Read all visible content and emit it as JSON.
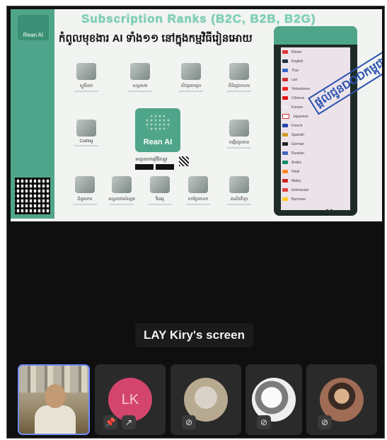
{
  "slide": {
    "sidebar_logo": "Rean AI",
    "banner": "Subscription Ranks (B2C, B2B, B2G)",
    "title": "កំពូលមុខងារ AI ទាំង១១ នៅក្នុងកម្មវិធីរៀនអោយ",
    "center_logo": "Rean AI",
    "store_caption": "ទាញយកកម្មវិធីឥឡូវ",
    "stamp": "ផ្តល់ជូនDODកម្ពុជា",
    "features": [
      {
        "label": "ស្ទូឌីយោ"
      },
      {
        "label": "សន្ទនាAI"
      },
      {
        "label": "សិក្សាតាមរូប"
      },
      {
        "label": "ពិនិត្យឯកសារ"
      },
      {
        "label": "Coding"
      },
      {
        "label": "បង្កើតរូបភាព"
      },
      {
        "label": "ជំនួយការ"
      },
      {
        "label": "សន្ទនាជាសំឡេង"
      },
      {
        "label": "វីដេអូ"
      },
      {
        "label": "បកប្រែភាសា"
      },
      {
        "label": "គណិតវិទ្យា"
      }
    ],
    "phone_languages": [
      "Khmer",
      "English",
      "Thai",
      "Lao",
      "Vietnamese",
      "Chinese",
      "Korean",
      "Japanese",
      "French",
      "Spanish",
      "German",
      "Russian",
      "Arabic",
      "Hindi",
      "Malay",
      "Indonesian",
      "Burmese"
    ],
    "phone_nav": "<  >"
  },
  "screen_share_label": "LAY Kiry's screen",
  "participants": [
    {
      "kind": "camera",
      "active": true
    },
    {
      "kind": "initials",
      "initials": "LK",
      "controls": [
        "pin-icon",
        "share-icon"
      ]
    },
    {
      "kind": "photo",
      "muted": true
    },
    {
      "kind": "photo",
      "muted": true
    },
    {
      "kind": "photo",
      "muted": true
    }
  ],
  "colors": {
    "accent_teal": "#4fa58a",
    "lk_avatar": "#d4456e",
    "active_border": "#6f8cff"
  }
}
